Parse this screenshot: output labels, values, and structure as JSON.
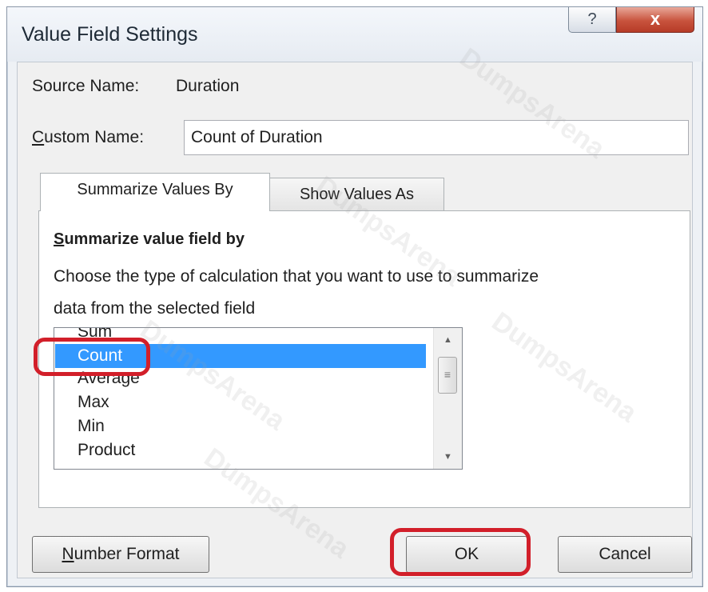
{
  "dialog": {
    "title": "Value Field Settings",
    "help_glyph": "?",
    "close_glyph": "x"
  },
  "source_name": {
    "label": "Source Name:",
    "value": "Duration"
  },
  "custom_name": {
    "label_first": "C",
    "label_rest": "ustom Name:",
    "value": "Count of Duration"
  },
  "tabs": [
    {
      "label": "Summarize Values By",
      "active": true
    },
    {
      "label": "Show Values As",
      "active": false
    }
  ],
  "summarize": {
    "heading_first": "S",
    "heading_rest": "ummarize value field by",
    "description_line1": "Choose the type of calculation that you want to use to summarize",
    "description_line2": "data from the selected field",
    "items": [
      "Sum",
      "Count",
      "Average",
      "Max",
      "Min",
      "Product"
    ],
    "selected": "Count"
  },
  "buttons": {
    "number_format_first": "N",
    "number_format_rest": "umber Format",
    "ok": "OK",
    "cancel": "Cancel"
  },
  "watermark_text": "DumpsArena",
  "colors": {
    "selection": "#3399ff",
    "highlight_annotation": "#d21f2a",
    "close_button": "#c8533d"
  }
}
